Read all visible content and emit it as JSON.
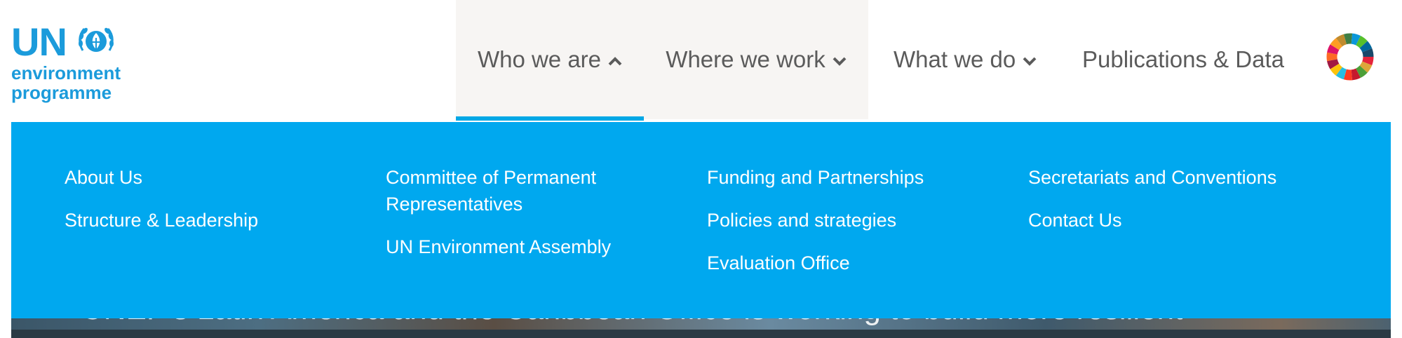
{
  "logo": {
    "un": "UN",
    "line1": "environment",
    "line2": "programme",
    "color": "#1b9bdb"
  },
  "nav": {
    "items": [
      {
        "label": "Who we are",
        "icon": "chevron-up-icon"
      },
      {
        "label": "Where we work",
        "icon": "chevron-down-icon"
      },
      {
        "label": "What we do",
        "icon": "chevron-down-icon"
      },
      {
        "label": "Publications & Data"
      }
    ],
    "active_index": 0,
    "sdg_icon": "sdg-wheel-icon"
  },
  "dropdown": {
    "background": "#00a8ef",
    "columns": [
      [
        "About Us",
        "Structure & Leadership"
      ],
      [
        "Committee of Permanent Representatives",
        "UN Environment Assembly"
      ],
      [
        "Funding and Partnerships",
        "Policies and strategies",
        "Evaluation Office"
      ],
      [
        "Secretariats and Conventions",
        "Contact Us"
      ]
    ]
  },
  "hero": {
    "text": "UNEP's Latin America and the Caribbean Office is working to build more resilient"
  }
}
